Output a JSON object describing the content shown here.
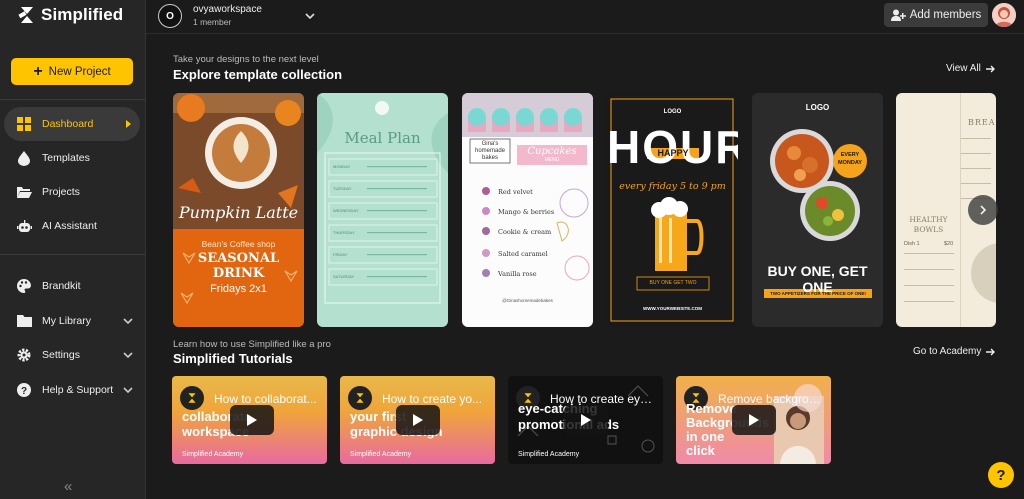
{
  "brand": {
    "name": "Simplified"
  },
  "sidebar": {
    "new_project": "New Project",
    "items": [
      {
        "label": "Dashboard",
        "icon": "grid-icon"
      },
      {
        "label": "Templates",
        "icon": "drop-icon"
      },
      {
        "label": "Projects",
        "icon": "folder-open-icon"
      },
      {
        "label": "AI Assistant",
        "icon": "robot-icon"
      },
      {
        "label": "Brandkit",
        "icon": "palette-icon"
      },
      {
        "label": "My Library",
        "icon": "folder-icon"
      },
      {
        "label": "Settings",
        "icon": "gear-icon"
      },
      {
        "label": "Help & Support",
        "icon": "question-icon"
      }
    ],
    "collapse": "«"
  },
  "topbar": {
    "workspace_initial": "O",
    "workspace_name": "ovyaworkspace",
    "workspace_members": "1 member",
    "add_members": "Add members"
  },
  "templates": {
    "subtitle": "Take your designs to the next level",
    "title": "Explore template collection",
    "view_all": "View All",
    "cards": [
      {
        "title": "Pumpkin Latte",
        "shop": "Bean's Coffee shop",
        "headline": "SEASONAL DRINK",
        "sub": "Fridays 2x1"
      },
      {
        "title": "Meal Plan",
        "days": [
          "MONDAY",
          "TUESDAY",
          "WEDNESDAY",
          "THURSDAY",
          "FRIDAY",
          "SATURDAY"
        ]
      },
      {
        "brand": "Gina's homemade bakes",
        "title": "Cupcakes",
        "menu": "MENU",
        "items": [
          "Red velvet",
          "Mango & berries",
          "Cookie & cream",
          "Salted caramel",
          "Vanilla rose"
        ],
        "footer": "@Ginashomemadebakes"
      },
      {
        "logo": "LOGO",
        "big": "HOUR",
        "happy": "HAPPY",
        "sub": "every friday 5 to 9 pm",
        "cta": "BUY ONE GET TWO",
        "web": "WWW.YOURWEBSITE.COM"
      },
      {
        "logo": "LOGO",
        "badge1": "EVERY",
        "badge2": "MONDAY",
        "headline": "BUY ONE, GET ONE",
        "strip": "TWO APPETIZERS FOR THE PRICE OF ONE!"
      },
      {
        "title": "HEALTHY BOWLS",
        "top": "BREA",
        "dish": "Dish 1",
        "price": "$20"
      }
    ]
  },
  "tutorials": {
    "subtitle": "Learn how to use Simplified like a pro",
    "title": "Simplified Tutorials",
    "go_to": "Go to Academy",
    "cards": [
      {
        "title": "How to collaborat...",
        "big1": "collaborate",
        "big2": "workspace",
        "brand": "Simplified Academy"
      },
      {
        "title": "How to create yo...",
        "big1": "your first",
        "big2": "graphic design",
        "brand": "Simplified Academy"
      },
      {
        "title": "How to create eye...",
        "big1": "eye-catching",
        "big2": "promotional ads",
        "brand": "Simplified Academy"
      },
      {
        "title": "Remove backgrou...",
        "big1": "Remove",
        "big2": "Backgrounds in one click",
        "brand": "Simplified Academy"
      }
    ]
  },
  "help": "?",
  "colors": {
    "accent": "#ffc400",
    "bg": "#1b1b1b",
    "sidebar": "#262626"
  }
}
